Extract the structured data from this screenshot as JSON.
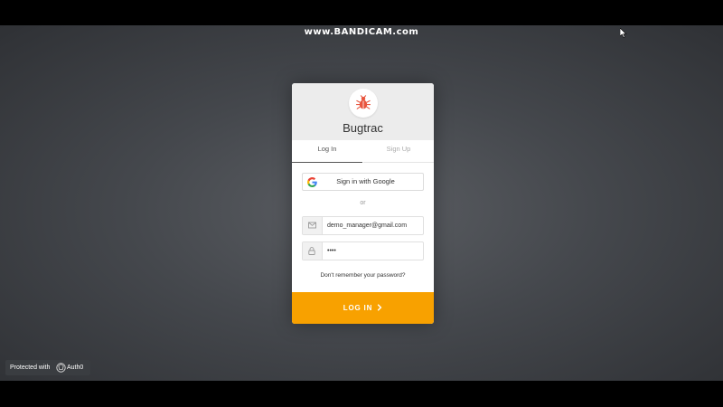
{
  "watermark": "www.BANDICAM.com",
  "card": {
    "app_name": "Bugtrac",
    "logo_icon": "bug-icon",
    "brand_color": "#e8553e",
    "tabs": [
      {
        "label": "Log In",
        "active": true
      },
      {
        "label": "Sign Up",
        "active": false
      }
    ],
    "google_button": {
      "label": "Sign in with Google",
      "icon": "google-icon"
    },
    "separator": "or",
    "email_field": {
      "value": "demo_manager@gmail.com",
      "icon": "mail-icon"
    },
    "password_field": {
      "value": "••••",
      "icon": "lock-icon"
    },
    "forgot_link": "Don't remember your password?",
    "submit_button": {
      "label": "LOG IN",
      "icon": "chevron-right-icon",
      "color": "#f8a100"
    }
  },
  "badge": {
    "protected_text": "Protected with",
    "brand": "Auth0",
    "icon": "auth0-shield-icon"
  }
}
